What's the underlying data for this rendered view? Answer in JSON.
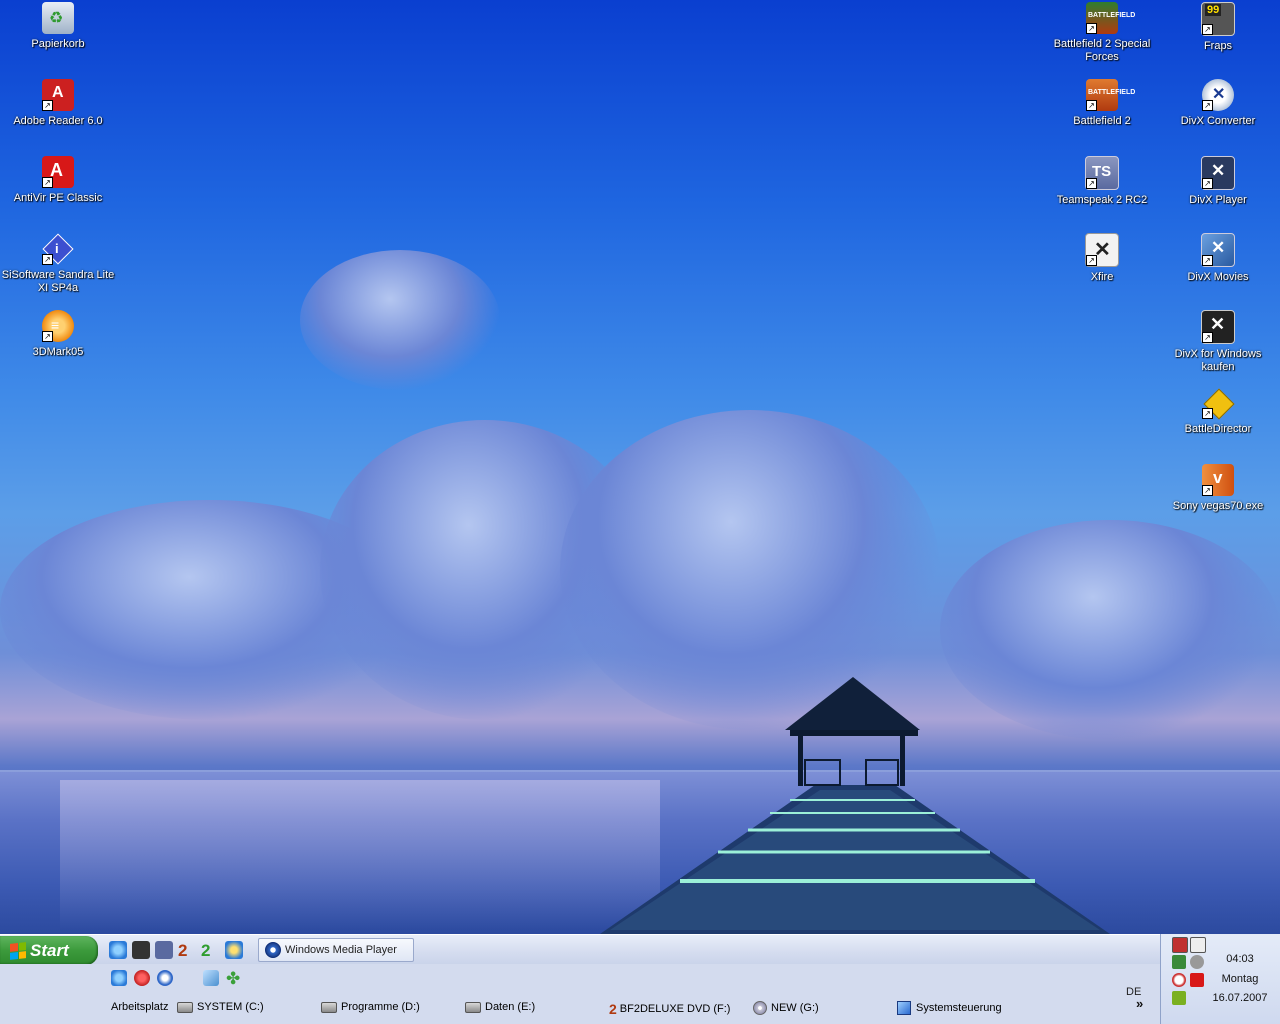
{
  "desktop": {
    "left_icons": [
      {
        "label": "Papierkorb",
        "icon": "recycle-bin-icon",
        "color": "#3a9a3a"
      },
      {
        "label": "Adobe Reader 6.0",
        "icon": "adobe-reader-icon",
        "color": "#cc2020"
      },
      {
        "label": "AntiVir PE Classic",
        "icon": "antivir-icon",
        "color": "#d81818"
      },
      {
        "label": "SiSoftware Sandra Lite XI SP4a",
        "icon": "sandra-icon",
        "color": "#3c4fd0"
      },
      {
        "label": "3DMark05",
        "icon": "3dmark-icon",
        "color": "#f08a10"
      }
    ],
    "right_col1": [
      {
        "label": "Battlefield 2 Special Forces",
        "icon": "battlefield-sf-icon",
        "color": "#2f7d2f"
      },
      {
        "label": "Battlefield 2",
        "icon": "battlefield-icon",
        "color": "#b03a10"
      },
      {
        "label": "Teamspeak 2 RC2",
        "icon": "teamspeak-icon",
        "color": "#5a6aa0"
      },
      {
        "label": "Xfire",
        "icon": "xfire-icon",
        "color": "#e8e8e8"
      }
    ],
    "right_col2": [
      {
        "label": "Fraps",
        "icon": "fraps-icon",
        "color": "#333333"
      },
      {
        "label": "DivX Converter",
        "icon": "divx-converter-icon",
        "color": "#dfe6f0"
      },
      {
        "label": "DivX Player",
        "icon": "divx-player-icon",
        "color": "#2a3a60"
      },
      {
        "label": "DivX Movies",
        "icon": "divx-movies-icon",
        "color": "#2a5aa0"
      },
      {
        "label": "DivX for Windows kaufen",
        "icon": "divx-buy-icon",
        "color": "#222222"
      },
      {
        "label": "BattleDirector",
        "icon": "battledirector-icon",
        "color": "#f0c010"
      },
      {
        "label": "Sony vegas70.exe",
        "icon": "sony-vegas-icon",
        "color": "#e07020"
      }
    ]
  },
  "taskbar": {
    "start_label": "Start",
    "quicklaunch": [
      {
        "icon": "ie-icon",
        "color": "#2a7ad8"
      },
      {
        "icon": "fraps-icon",
        "color": "#333333"
      },
      {
        "icon": "teamspeak-icon",
        "color": "#5a6aa0"
      },
      {
        "icon": "bf2-icon",
        "color": "#b03a10"
      },
      {
        "icon": "bf2sf-icon",
        "color": "#2f9d2f"
      },
      {
        "icon": "ie-alt-icon",
        "color": "#2a7ad8"
      },
      {
        "icon": "ie-small-icon",
        "color": "#2a7ad8"
      },
      {
        "icon": "record-icon",
        "color": "#c02020"
      },
      {
        "icon": "media-player-icon",
        "color": "#2f67c8"
      },
      {
        "icon": "network-icon",
        "color": "#4a90d0"
      },
      {
        "icon": "clover-icon",
        "color": "#3aa03a"
      }
    ],
    "task_button": "Windows Media Player",
    "language": "DE",
    "drives_toolbar": [
      {
        "label": "Arbeitsplatz",
        "icon": ""
      },
      {
        "label": "SYSTEM (C:)",
        "icon": "drive-icon"
      },
      {
        "label": "Programme (D:)",
        "icon": "drive-icon"
      },
      {
        "label": "Daten (E:)",
        "icon": "drive-icon"
      },
      {
        "label": "BF2DELUXE DVD (F:)",
        "icon": "dvd-icon"
      },
      {
        "label": "NEW (G:)",
        "icon": "cd-icon"
      },
      {
        "label": "Systemsteuerung",
        "icon": "control-panel-icon"
      }
    ],
    "more_label": "»"
  },
  "tray": {
    "time": "04:03",
    "day": "Montag",
    "date": "16.07.2007",
    "icons": [
      {
        "icon": "monitor-icon",
        "color": "#c03030"
      },
      {
        "icon": "xfire-tray-icon",
        "color": "#666666"
      },
      {
        "icon": "network-tray-icon",
        "color": "#3a8a3a"
      },
      {
        "icon": "speaker-icon",
        "color": "#888888"
      },
      {
        "icon": "clock-tray-icon",
        "color": "#cc3333"
      },
      {
        "icon": "antivir-tray-icon",
        "color": "#d81818"
      },
      {
        "icon": "nvidia-icon",
        "color": "#7ab020"
      }
    ]
  }
}
